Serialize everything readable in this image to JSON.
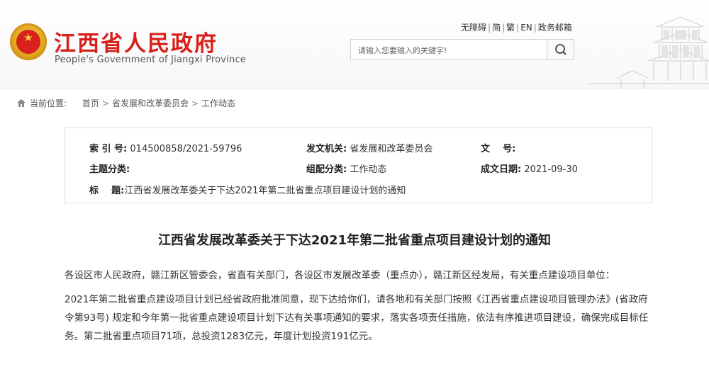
{
  "header": {
    "site_title": "江西省人民政府",
    "site_subtitle": "People's Government of Jiangxi Province",
    "top_links": [
      "无障碍",
      "简",
      "繁",
      "EN",
      "政务邮箱"
    ],
    "search_placeholder": "请输入您要输入的关键字!"
  },
  "breadcrumb": {
    "label": "当前位置:",
    "items": [
      "首页",
      "省发展和改革委员会",
      "工作动态"
    ]
  },
  "info": {
    "index_label": "索 引 号:",
    "index_value": "014500858/2021-59796",
    "issuer_label": "发文机关:",
    "issuer_value": "省发展和改革委员会",
    "docno_label": "文    号:",
    "docno_value": "",
    "topic_label": "主题分类:",
    "topic_value": "",
    "category_label": "组配分类:",
    "category_value": "工作动态",
    "date_label": "成文日期:",
    "date_value": "2021-09-30",
    "title_label": "标    题:",
    "title_value": "江西省发展改革委关于下达2021年第二批省重点项目建设计划的通知"
  },
  "article": {
    "title": "江西省发展改革委关于下达2021年第二批省重点项目建设计划的通知",
    "paragraphs": [
      "各设区市人民政府，赣江新区管委会，省直有关部门，各设区市发展改革委（重点办），赣江新区经发局，有关重点建设项目单位：",
      "2021年第二批省重点建设项目计划已经省政府批准同意，现下达给你们，请各地和有关部门按照《江西省重点建设项目管理办法》(省政府令第93号) 规定和今年第一批省重点建设项目计划下达有关事项通知的要求，落实各项责任措施，依法有序推进项目建设，确保完成目标任务。第二批省重点项目71项，总投资1283亿元，年度计划投资191亿元。"
    ]
  },
  "colors": {
    "brand_red": "#d8201a",
    "emblem_gold": "#e0a81e"
  },
  "icons": [
    "national-emblem-icon",
    "search-icon",
    "home-icon",
    "pavilion-illustration"
  ]
}
